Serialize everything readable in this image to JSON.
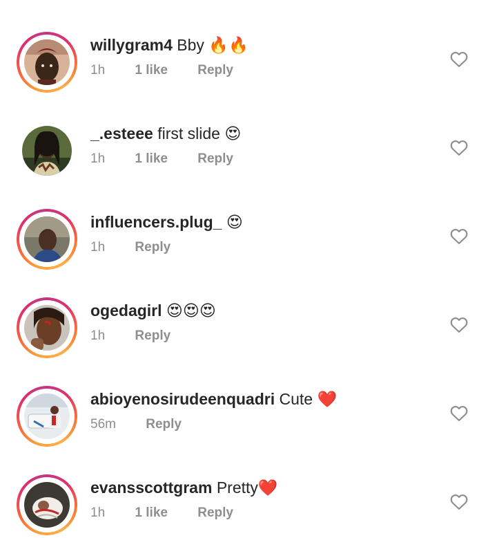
{
  "comments": [
    {
      "username": "willygram4",
      "text": "Bby 🔥🔥",
      "time": "1h",
      "likes": "1 like",
      "reply": "Reply",
      "has_story": true
    },
    {
      "username": "_.esteee",
      "text": "first slide 😍",
      "time": "1h",
      "likes": "1 like",
      "reply": "Reply",
      "has_story": false
    },
    {
      "username": "influencers.plug_",
      "text": "😍",
      "time": "1h",
      "likes": "",
      "reply": "Reply",
      "has_story": true
    },
    {
      "username": "ogedagirl",
      "text": "😍😍😍",
      "time": "1h",
      "likes": "",
      "reply": "Reply",
      "has_story": true
    },
    {
      "username": "abioyenosirudeenquadri",
      "text": "Cute ❤️",
      "time": "56m",
      "likes": "",
      "reply": "Reply",
      "has_story": true
    },
    {
      "username": "evansscottgram",
      "text": "Pretty❤️",
      "time": "1h",
      "likes": "1 like",
      "reply": "Reply",
      "has_story": true
    }
  ],
  "icons": {
    "like": "heart-outline-icon"
  },
  "colors": {
    "primary_text": "#262626",
    "secondary_text": "#8e8e8e",
    "heart_outline": "#8e8e8e"
  }
}
